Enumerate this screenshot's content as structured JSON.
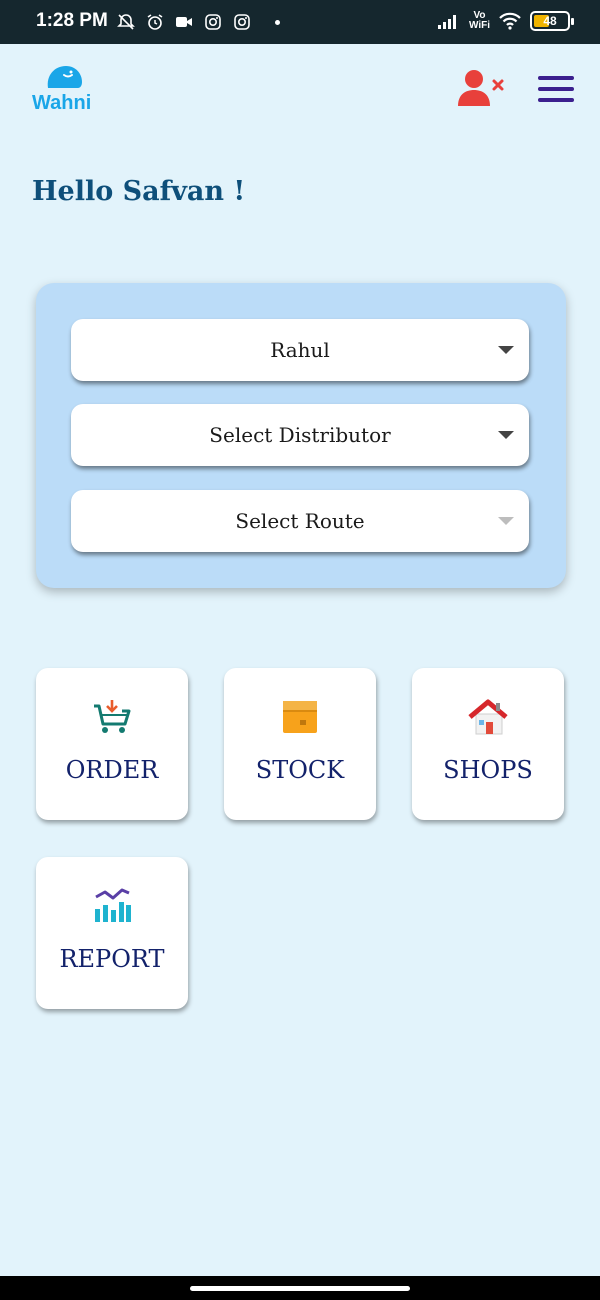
{
  "status_bar": {
    "time": "1:28 PM",
    "network_label_top": "Vo",
    "network_label_bottom": "WiFi",
    "battery_level": "48",
    "battery_fraction": 0.48
  },
  "header": {
    "logo_text": "Wahni",
    "icons": [
      "user-remove-icon",
      "hamburger-menu-icon"
    ]
  },
  "greeting": "Hello Safvan !",
  "selectors": [
    {
      "value": "Rahul",
      "enabled": true
    },
    {
      "value": "Select Distributor",
      "enabled": true
    },
    {
      "value": "Select Route",
      "enabled": false
    }
  ],
  "tiles": [
    {
      "label": "ORDER",
      "icon": "cart-icon"
    },
    {
      "label": "STOCK",
      "icon": "box-icon"
    },
    {
      "label": "SHOPS",
      "icon": "shop-house-icon"
    },
    {
      "label": "REPORT",
      "icon": "chart-icon"
    }
  ],
  "colors": {
    "background": "#e2f3fb",
    "accent_blue": "#1aa6e8",
    "greeting": "#0e4f7a",
    "tile_text": "#13226b",
    "menu": "#3b1f8e",
    "user_icon_red": "#e8403b"
  }
}
